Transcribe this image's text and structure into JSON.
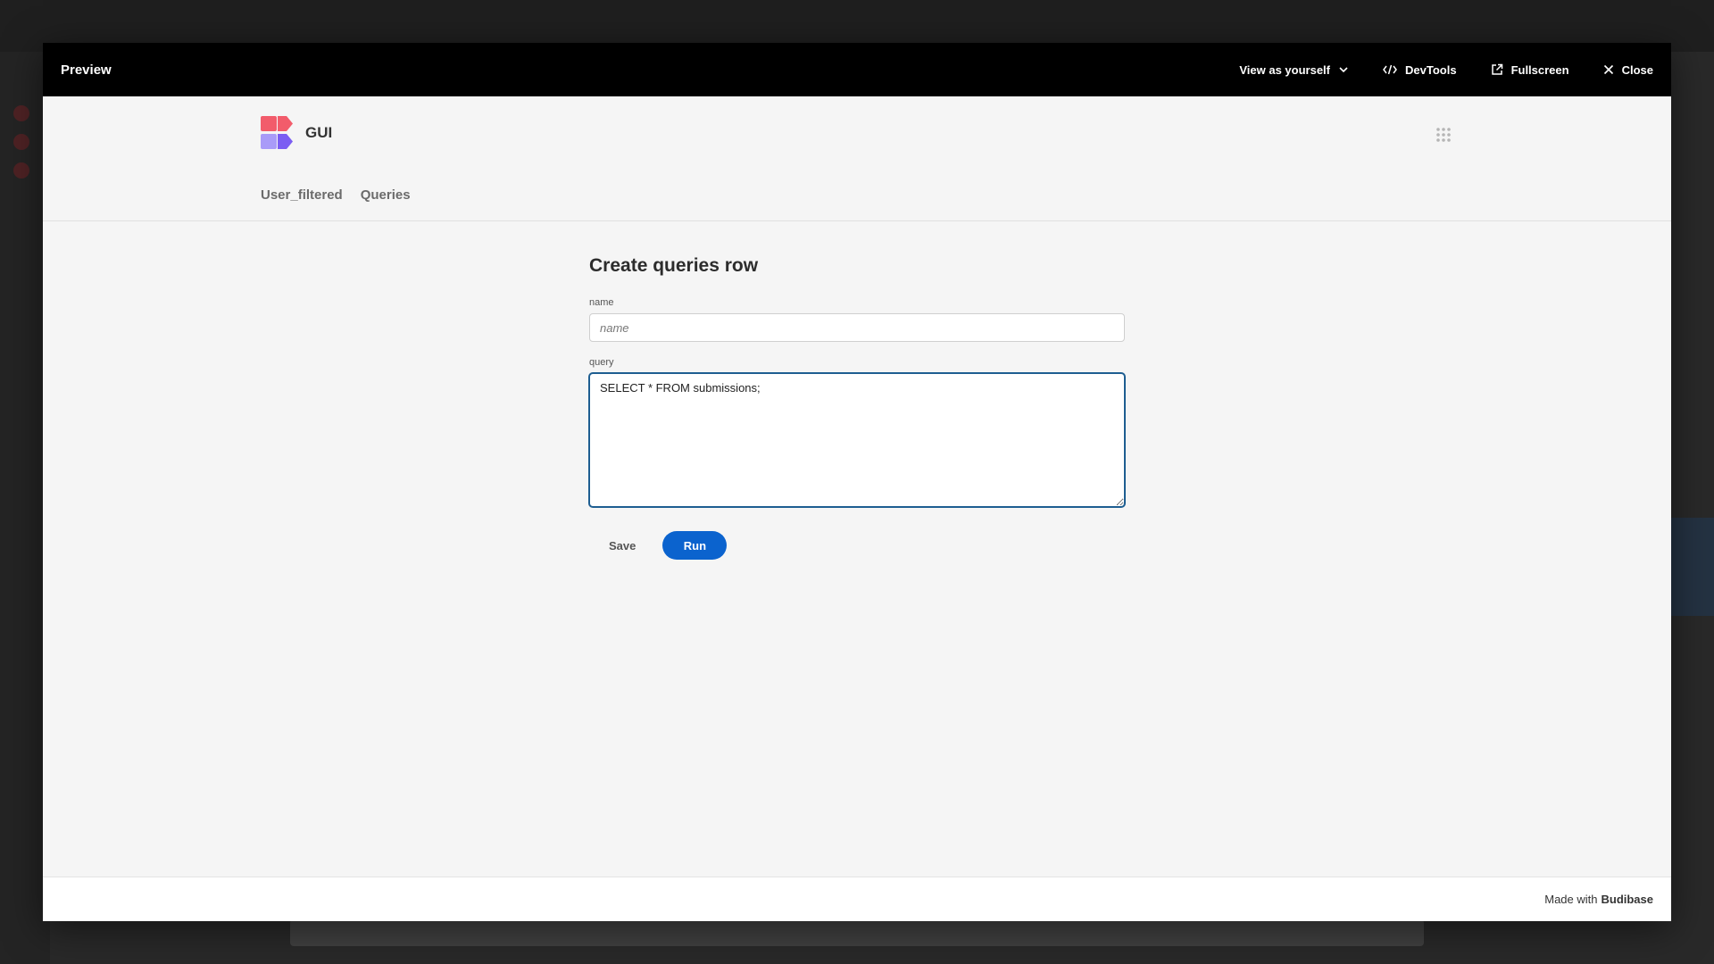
{
  "modal": {
    "title": "Preview",
    "actions": {
      "view_as": "View as yourself",
      "devtools": "DevTools",
      "fullscreen": "Fullscreen",
      "close": "Close"
    }
  },
  "app": {
    "name": "GUI",
    "nav": [
      "User_filtered",
      "Queries"
    ]
  },
  "form": {
    "title": "Create queries row",
    "fields": {
      "name": {
        "label": "name",
        "placeholder": "name",
        "value": ""
      },
      "query": {
        "label": "query",
        "value": "SELECT * FROM submissions;"
      }
    },
    "save_label": "Save",
    "run_label": "Run"
  },
  "footer": {
    "prefix": "Made with",
    "brand": "Budibase"
  },
  "colors": {
    "primary": "#0b63ce",
    "header_bg": "#000000",
    "logo_red": "#f25c6b",
    "logo_purple": "#8b7cf6"
  },
  "icons": {
    "dropdown": "chevron-down-icon",
    "devtools": "code-icon",
    "fullscreen": "external-link-icon",
    "close": "close-icon",
    "apps": "grid-dots-icon"
  }
}
